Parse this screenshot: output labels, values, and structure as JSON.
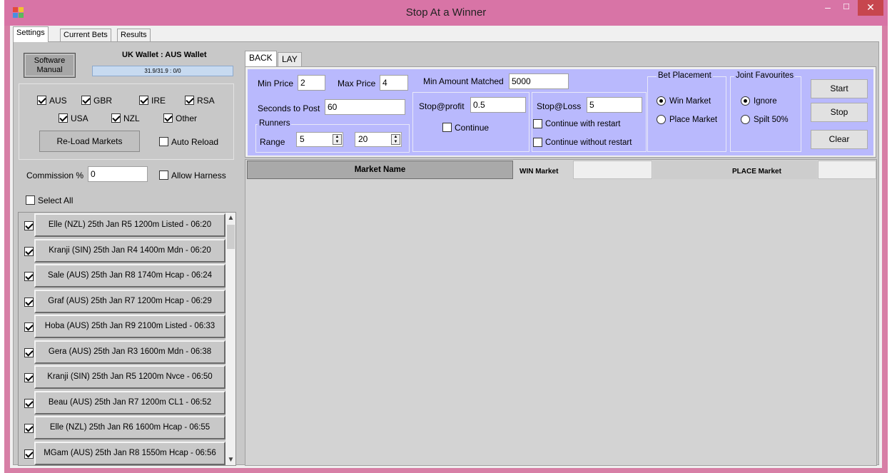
{
  "window": {
    "title": "Stop At a Winner",
    "min_glyph": "–",
    "max_glyph": "☐",
    "close_glyph": "✕"
  },
  "tabs": [
    "Settings",
    "Current Bets",
    "Results"
  ],
  "left": {
    "manual_label": "Software Manual",
    "wallet_title": "UK Wallet : AUS Wallet",
    "wallet_value": "31.9/31.9  :  0/0",
    "countries": [
      {
        "label": "AUS",
        "checked": true
      },
      {
        "label": "GBR",
        "checked": true
      },
      {
        "label": "IRE",
        "checked": true
      },
      {
        "label": "RSA",
        "checked": true
      },
      {
        "label": "USA",
        "checked": true
      },
      {
        "label": "NZL",
        "checked": true
      },
      {
        "label": "Other",
        "checked": true
      }
    ],
    "reload_label": "Re-Load Markets",
    "auto_reload_label": "Auto Reload",
    "commission_label": "Commission %",
    "commission_value": "0",
    "allow_harness_label": "Allow Harness",
    "select_all_label": "Select All",
    "markets": [
      "Elle (NZL) 25th Jan R5 1200m Listed - 06:20",
      "Kranji (SIN) 25th Jan R4 1400m Mdn - 06:20",
      "Sale (AUS) 25th Jan R8 1740m Hcap - 06:24",
      "Graf (AUS) 25th Jan R7 1200m Hcap - 06:29",
      "Hoba (AUS) 25th Jan R9 2100m Listed - 06:33",
      "Gera (AUS) 25th Jan R3 1600m Mdn - 06:38",
      "Kranji (SIN) 25th Jan R5 1200m Nvce - 06:50",
      "Beau (AUS) 25th Jan R7 1200m CL1 - 06:52",
      "Elle (NZL) 25th Jan R6 1600m Hcap - 06:55",
      "MGam (AUS) 25th Jan R8 1550m Hcap - 06:56"
    ]
  },
  "bet_tabs": [
    "BACK",
    "LAY"
  ],
  "back": {
    "min_price_label": "Min Price",
    "min_price": "2",
    "max_price_label": "Max Price",
    "max_price": "4",
    "min_matched_label": "Min Amount Matched",
    "min_matched": "5000",
    "seconds_label": "Seconds to Post",
    "seconds": "60",
    "runners_title": "Runners",
    "range_label": "Range",
    "range_min": "5",
    "range_max": "20",
    "stop_profit_label": "Stop@profit",
    "stop_profit": "0.5",
    "continue_label": "Continue",
    "stop_loss_label": "Stop@Loss",
    "stop_loss": "5",
    "continue_restart_label": "Continue with restart",
    "continue_norestart_label": "Continue without restart",
    "bet_placement_title": "Bet Placement",
    "win_market_label": "Win Market",
    "place_market_label": "Place Market",
    "joint_fav_title": "Joint Favourites",
    "ignore_label": "Ignore",
    "split_label": "Spilt 50%",
    "start_label": "Start",
    "stop_label": "Stop",
    "clear_label": "Clear"
  },
  "grid": {
    "market_name_header": "Market Name",
    "win_market_header": "WIN Market",
    "place_market_header": "PLACE Market"
  },
  "colors": {
    "titlebar": "#d874a6",
    "back_panel": "#b9b9fd",
    "close_button": "#c7464e"
  }
}
